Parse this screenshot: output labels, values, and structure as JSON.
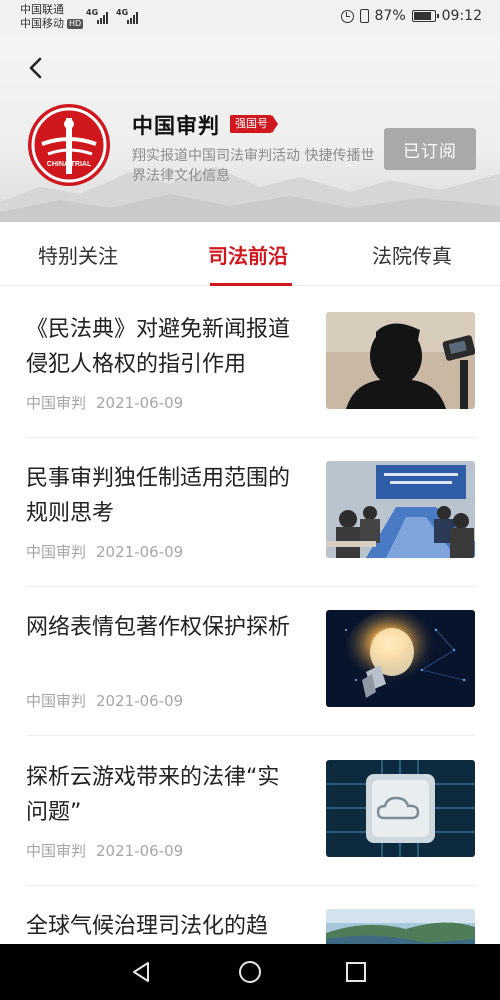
{
  "status_bar": {
    "carrier_1": "中国联通",
    "carrier_2": "中国移动",
    "hd_badge": "HD",
    "network_1": "4G",
    "network_2": "4G",
    "battery_percent": "87%",
    "battery_level": 0.87,
    "time": "09:12"
  },
  "header": {
    "source_name": "中国审判",
    "source_badge": "强国号",
    "description": "翔实报道中国司法审判活动 快捷传播世界法律文化信息",
    "subscribe_label": "已订阅",
    "logo_text": "CHINA TRIAL",
    "colors": {
      "brand_red": "#d0171d",
      "subscribed_gray": "#a9a9a9"
    }
  },
  "tabs": [
    {
      "label": "特别关注",
      "active": false
    },
    {
      "label": "司法前沿",
      "active": true
    },
    {
      "label": "法院传真",
      "active": false
    }
  ],
  "articles": [
    {
      "title": "《民法典》对避免新闻报道侵犯人格权的指引作用",
      "source": "中国审判",
      "date": "2021-06-09",
      "thumbnail": "silhouette-camera-image"
    },
    {
      "title": "民事审判独任制适用范围的规则思考",
      "source": "中国审判",
      "date": "2021-06-09",
      "thumbnail": "conference-meeting-image"
    },
    {
      "title": "网络表情包著作权保护探析",
      "source": "中国审判",
      "date": "2021-06-09",
      "thumbnail": "light-bulb-image"
    },
    {
      "title": "探析云游戏带来的法律“实问题”",
      "source": "中国审判",
      "date": "2021-06-09",
      "thumbnail": "cloud-chip-image"
    },
    {
      "title": "全球气候治理司法化的趋",
      "source": "",
      "date": "",
      "thumbnail": "landscape-image"
    }
  ],
  "nav_bar": {
    "icons": [
      "back-triangle-icon",
      "home-circle-icon",
      "recents-square-icon"
    ]
  }
}
